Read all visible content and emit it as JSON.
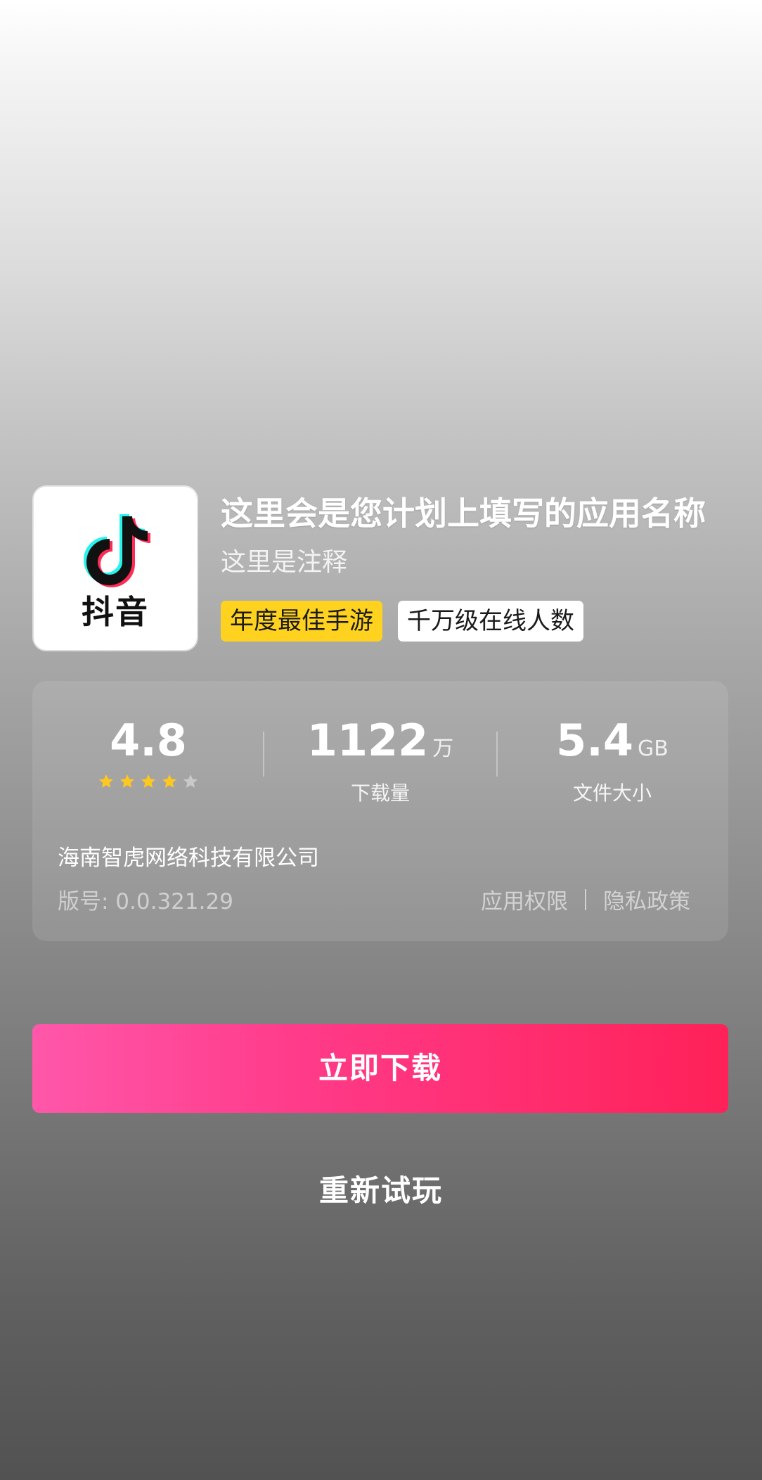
{
  "app": {
    "icon_label": "抖音",
    "name": "这里会是您计划上填写的应用名称",
    "subtitle": "这里是注释",
    "tags": [
      "年度最佳手游",
      "千万级在线人数"
    ]
  },
  "stats": {
    "rating": "4.8",
    "rating_stars": 4,
    "rating_stars_max": 5,
    "downloads_value": "1122",
    "downloads_unit": "万",
    "downloads_label": "下载量",
    "size_value": "5.4",
    "size_unit": "GB",
    "size_label": "文件大小"
  },
  "details": {
    "company": "海南智虎网络科技有限公司",
    "version": "版号: 0.0.321.29",
    "permissions_link": "应用权限",
    "privacy_link": "隐私政策"
  },
  "actions": {
    "download": "立即下载",
    "retry": "重新试玩"
  },
  "colors": {
    "download_start": "#ff57aa",
    "download_end": "#ff2158",
    "tag_highlight": "#ffd21f",
    "star_on": "#ffc81e",
    "star_off": "#c9c9c9"
  }
}
